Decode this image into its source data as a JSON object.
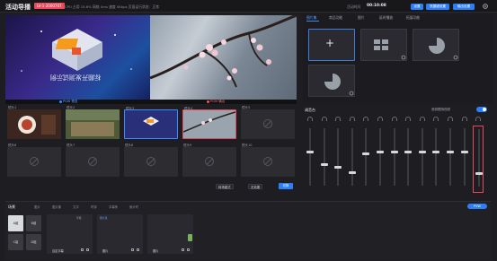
{
  "topbar": {
    "title": "活动导播",
    "event_id": "LV-1-2000707",
    "stats": "CPU 占用 15.6%   网络 0ms   速度 0Kbps   页面运行状态：正常",
    "timer_label": "活动时间",
    "timer_value": "00:10:08",
    "buttons": [
      "设置",
      "快捷键设置",
      "输出设置"
    ]
  },
  "preview": {
    "pvw_tag": "PVW 预览",
    "pgm_tag": "PGM 输出",
    "pvw_overlay_text": "标题开发测试示例"
  },
  "scenes": [
    {
      "name": "镜头1"
    },
    {
      "name": "镜头2"
    },
    {
      "name": "镜头3"
    },
    {
      "name": "镜头4"
    },
    {
      "name": "镜头5"
    },
    {
      "name": "镜头6"
    },
    {
      "name": "镜头7"
    },
    {
      "name": "镜头8"
    },
    {
      "name": "镜头9"
    },
    {
      "name": "镜头10"
    }
  ],
  "scene_toolbar": {
    "transition": "转场模式",
    "effect": "无效果",
    "switch": "切换"
  },
  "right_tabs": [
    "图片集",
    "商品功能",
    "图片",
    "延时播放",
    "拓展功能"
  ],
  "mixer": {
    "title": "调音台",
    "toggle_label": "音频跟随视频",
    "toggle_on": true,
    "levels": [
      0.58,
      0.35,
      0.3,
      0.2,
      0.55,
      0.58,
      0.58,
      0.58,
      0.58,
      0.58,
      0.58,
      0.58,
      0.2
    ]
  },
  "bottom": {
    "title": "场景",
    "tools": [
      "图片",
      "图片集",
      "文字",
      "时钟",
      "字幕条",
      "倒计时"
    ],
    "pvw_button": "PVW",
    "layers": [
      "A组",
      "B组",
      "C组",
      "D组"
    ],
    "assets": [
      {
        "name": "自定字幕",
        "badge": "字幕"
      },
      {
        "name": "图片",
        "badge": "图片集"
      },
      {
        "name": "图片",
        "badge": ""
      }
    ]
  },
  "colors": {
    "accent": "#2d7ff9",
    "pgm": "#e94a5e",
    "pvw": "#3a8bff"
  }
}
